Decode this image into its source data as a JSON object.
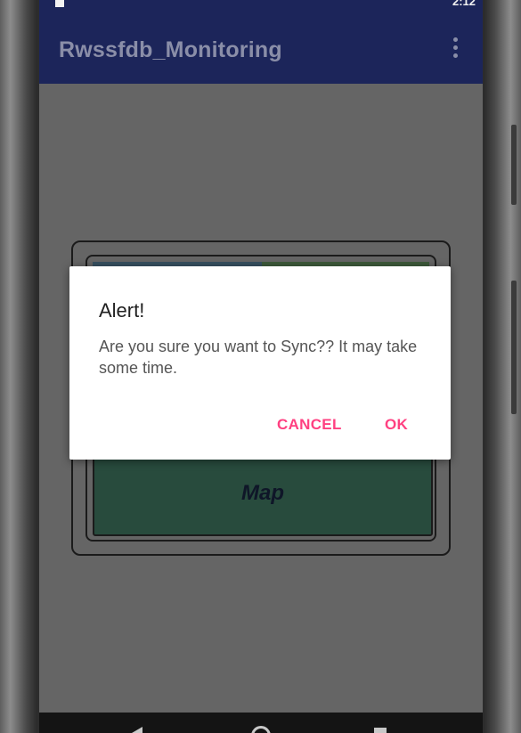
{
  "status_bar": {
    "time": "2:12"
  },
  "app_bar": {
    "title": "Rwssfdb_Monitoring",
    "overflow_icon": "more-vert-icon"
  },
  "content": {
    "map_tile_label": "Map"
  },
  "dialog": {
    "title": "Alert!",
    "message": "Are you sure you want to Sync?? It may take some time.",
    "cancel_label": "CANCEL",
    "ok_label": "OK",
    "accent_color": "#ff4081"
  },
  "colors": {
    "app_bar": "#1c255a",
    "dim_background": "#656565",
    "map_tile": "#284b3d"
  },
  "nav_bar": {
    "back_icon": "back-icon",
    "home_icon": "home-icon",
    "recents_icon": "recents-icon"
  }
}
